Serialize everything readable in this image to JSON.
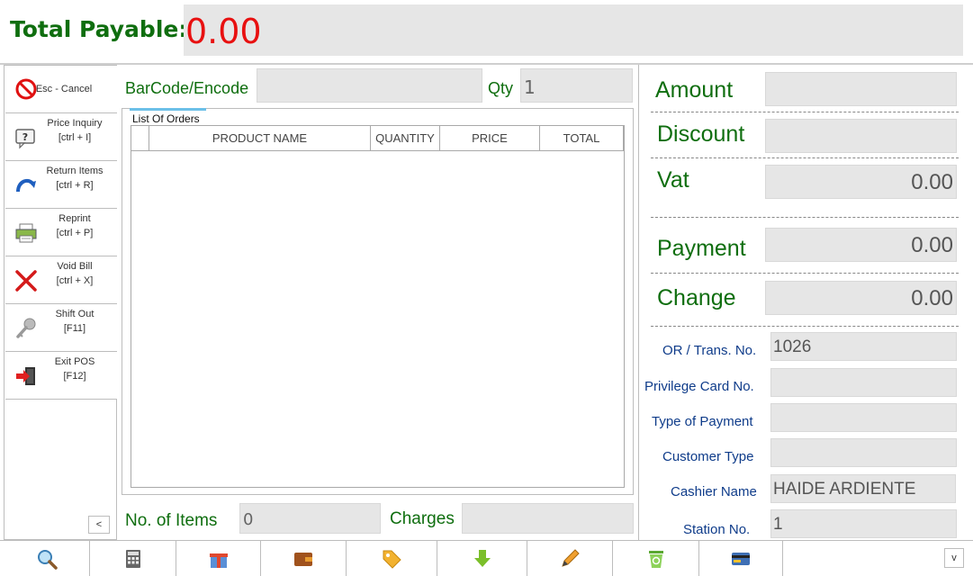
{
  "header": {
    "total_label": "Total Payable:",
    "total_value": "0.00"
  },
  "sidebar": {
    "items": [
      {
        "label": "Esc - Cancel",
        "icon": "cancel-icon"
      },
      {
        "label": "Price Inquiry",
        "shortcut": "[ctrl + I]",
        "icon": "price-inquiry-icon"
      },
      {
        "label": "Return Items",
        "shortcut": "[ctrl + R]",
        "icon": "return-icon"
      },
      {
        "label": "Reprint",
        "shortcut": "[ctrl + P]",
        "icon": "printer-icon"
      },
      {
        "label": "Void Bill",
        "shortcut": "[ctrl + X]",
        "icon": "void-icon"
      },
      {
        "label": "Shift Out",
        "shortcut": "[F11]",
        "icon": "key-icon"
      },
      {
        "label": "Exit POS",
        "shortcut": "[F12]",
        "icon": "exit-icon"
      }
    ],
    "collapse_label": "<"
  },
  "entry": {
    "barcode_label": "BarCode/Encode",
    "barcode_value": "",
    "qty_label": "Qty",
    "qty_value": "1"
  },
  "orders": {
    "title": "List Of Orders",
    "columns": [
      "PRODUCT NAME",
      "QUANTITY",
      "PRICE",
      "TOTAL"
    ],
    "rows": []
  },
  "footer_mid": {
    "items_label": "No. of Items",
    "items_value": "0",
    "charges_label": "Charges",
    "charges_value": ""
  },
  "summary": {
    "amount_label": "Amount",
    "amount_value": "",
    "discount_label": "Discount",
    "discount_value": "",
    "vat_label": "Vat",
    "vat_value": "0.00",
    "payment_label": "Payment",
    "payment_value": "0.00",
    "change_label": "Change",
    "change_value": "0.00"
  },
  "details": {
    "or_label": "OR / Trans. No.",
    "or_value": "1026",
    "privilege_label": "Privilege Card No.",
    "privilege_value": "",
    "payment_type_label": "Type of Payment",
    "payment_type_value": "",
    "customer_type_label": "Customer Type",
    "customer_type_value": "",
    "cashier_label": "Cashier Name",
    "cashier_value": "HAIDE ARDIENTE",
    "station_label": "Station No.",
    "station_value": "1"
  },
  "toolbar": {
    "icons": [
      "search-icon",
      "calculator-icon",
      "gift-icon",
      "wallet-icon",
      "tag-icon",
      "download-icon",
      "pencil-icon",
      "trash-icon",
      "card-icon"
    ],
    "expand_label": "v"
  },
  "colors": {
    "label_green": "#0f6e0f",
    "total_red": "#e81010",
    "detail_blue": "#0f3c8a",
    "field_gray": "#e6e6e6"
  }
}
